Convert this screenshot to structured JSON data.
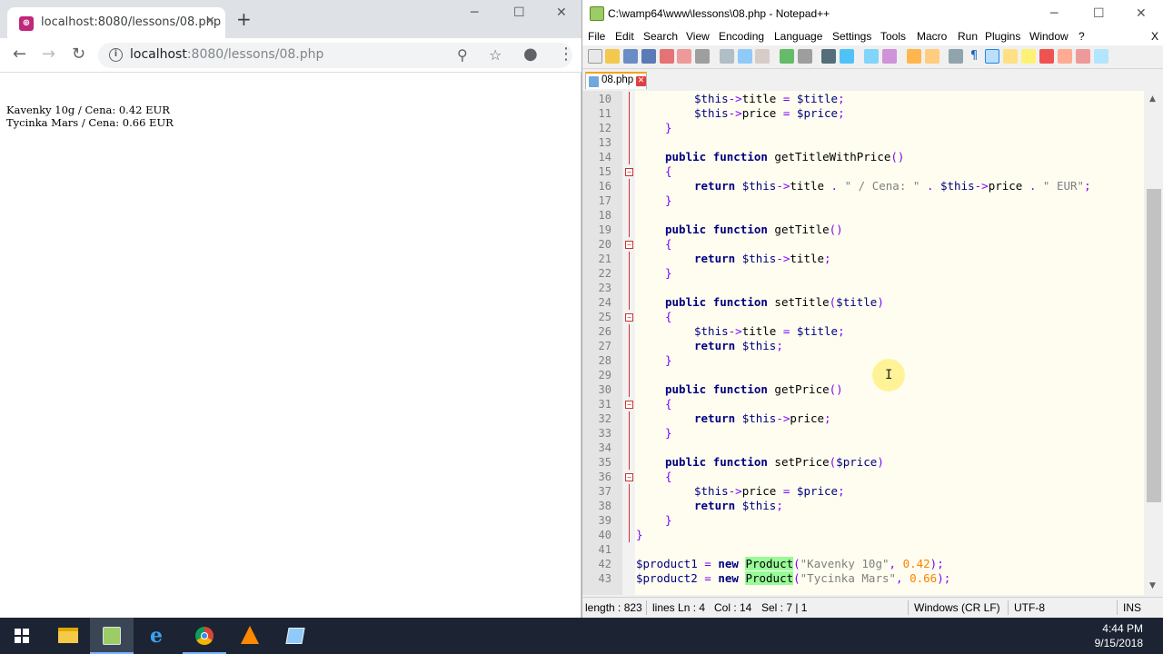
{
  "browser": {
    "tab_title": "localhost:8080/lessons/08.php",
    "tab_favicon": "php-icon",
    "url_host": "localhost",
    "url_path": ":8080/lessons/08.php",
    "page_lines": [
      "Kavenky 10g / Cena: 0.42 EUR",
      "Tycinka Mars / Cena: 0.66 EUR"
    ]
  },
  "editor": {
    "window_title": "C:\\wamp64\\www\\lessons\\08.php - Notepad++",
    "menu": [
      "File",
      "Edit",
      "Search",
      "View",
      "Encoding",
      "Language",
      "Settings",
      "Tools",
      "Macro",
      "Run",
      "Plugins",
      "Window",
      "?"
    ],
    "menu_close": "X",
    "file_tab": "08.php",
    "lines": [
      {
        "n": "10",
        "code": "$this->title = $title;"
      },
      {
        "n": "11",
        "code": "$this->price = $price;"
      },
      {
        "n": "12",
        "code": "}"
      },
      {
        "n": "13",
        "code": ""
      },
      {
        "n": "14",
        "code": "public function getTitleWithPrice()"
      },
      {
        "n": "15",
        "code": "{"
      },
      {
        "n": "16",
        "code": "return $this->title . \" / Cena: \" . $this->price . \" EUR\";"
      },
      {
        "n": "17",
        "code": "}"
      },
      {
        "n": "18",
        "code": ""
      },
      {
        "n": "19",
        "code": "public function getTitle()"
      },
      {
        "n": "20",
        "code": "{"
      },
      {
        "n": "21",
        "code": "return $this->title;"
      },
      {
        "n": "22",
        "code": "}"
      },
      {
        "n": "23",
        "code": ""
      },
      {
        "n": "24",
        "code": "public function setTitle($title)"
      },
      {
        "n": "25",
        "code": "{"
      },
      {
        "n": "26",
        "code": "$this->title = $title;"
      },
      {
        "n": "27",
        "code": "return $this;"
      },
      {
        "n": "28",
        "code": "}"
      },
      {
        "n": "29",
        "code": ""
      },
      {
        "n": "30",
        "code": "public function getPrice()"
      },
      {
        "n": "31",
        "code": "{"
      },
      {
        "n": "32",
        "code": "return $this->price;"
      },
      {
        "n": "33",
        "code": "}"
      },
      {
        "n": "34",
        "code": ""
      },
      {
        "n": "35",
        "code": "public function setPrice($price)"
      },
      {
        "n": "36",
        "code": "{"
      },
      {
        "n": "37",
        "code": "$this->price = $price;"
      },
      {
        "n": "38",
        "code": "return $this;"
      },
      {
        "n": "39",
        "code": "}"
      },
      {
        "n": "40",
        "code": "}"
      },
      {
        "n": "41",
        "code": ""
      },
      {
        "n": "42",
        "code": "$product1 = new Product(\"Kavenky 10g\", 0.42);"
      },
      {
        "n": "43",
        "code": "$product2 = new Product(\"Tycinka Mars\", 0.66);"
      }
    ],
    "status": {
      "length": "length : 823",
      "lines": "lines Ln : 4",
      "col": "Col : 14",
      "sel": "Sel : 7 | 1",
      "eol": "Windows (CR LF)",
      "encoding": "UTF-8",
      "mode": "INS"
    }
  },
  "taskbar": {
    "apps": [
      "file-explorer-icon",
      "notepad-plus-plus-icon",
      "edge-icon",
      "chrome-icon",
      "vlc-icon",
      "app-icon"
    ],
    "time": "4:44 PM",
    "date": "9/15/2018"
  },
  "colors": {
    "keyword": "#000080",
    "string": "#808080",
    "number": "#ff8000",
    "operator": "#8000ff",
    "highlight": "#98fb98",
    "taskbar": "#1c2433"
  }
}
